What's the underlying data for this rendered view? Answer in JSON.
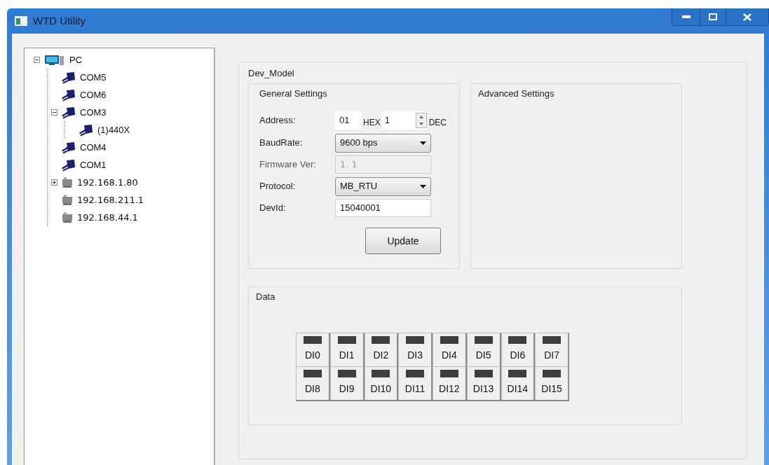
{
  "window": {
    "title": "WTD Utility"
  },
  "tree": [
    {
      "label": "PC",
      "kind": "pc",
      "expanded": true,
      "children": [
        {
          "label": "COM5",
          "kind": "serial"
        },
        {
          "label": "COM6",
          "kind": "serial"
        },
        {
          "label": "COM3",
          "kind": "serial",
          "expanded": true,
          "children": [
            {
              "label": "(1)440X",
              "kind": "serial"
            }
          ]
        },
        {
          "label": "COM4",
          "kind": "serial"
        },
        {
          "label": "COM1",
          "kind": "serial"
        },
        {
          "label": "192.168.1.80",
          "kind": "network",
          "expanded": false
        },
        {
          "label": "192.168.211.1",
          "kind": "network"
        },
        {
          "label": "192.168.44.1",
          "kind": "network"
        }
      ]
    }
  ],
  "dev_model": {
    "title": "Dev_Model",
    "general_settings": {
      "title": "General Settings",
      "address": {
        "label": "Address:",
        "hex_value": "01",
        "hex_unit": "HEX",
        "dec_value": "1",
        "dec_unit": "DEC"
      },
      "fields": [
        {
          "kind": "dropdown",
          "label": "BaudRate:",
          "value": "9600 bps"
        },
        {
          "kind": "text",
          "label": "Firmware Ver:",
          "value": "1. 1",
          "disabled": true
        },
        {
          "kind": "dropdown",
          "label": "Protocol:",
          "value": "MB_RTU"
        },
        {
          "kind": "text",
          "label": "DevId:",
          "value": "15040001",
          "disabled": false
        }
      ],
      "update_button": "Update"
    },
    "advanced_settings": {
      "title": "Advanced Settings"
    },
    "data": {
      "title": "Data",
      "inputs": [
        {
          "label": "DI0",
          "on": false
        },
        {
          "label": "DI1",
          "on": false
        },
        {
          "label": "DI2",
          "on": false
        },
        {
          "label": "DI3",
          "on": false
        },
        {
          "label": "DI4",
          "on": false
        },
        {
          "label": "DI5",
          "on": false
        },
        {
          "label": "DI6",
          "on": false
        },
        {
          "label": "DI7",
          "on": false
        },
        {
          "label": "DI8",
          "on": false
        },
        {
          "label": "DI9",
          "on": false
        },
        {
          "label": "DI10",
          "on": false
        },
        {
          "label": "DI11",
          "on": false
        },
        {
          "label": "DI12",
          "on": false
        },
        {
          "label": "DI13",
          "on": false
        },
        {
          "label": "DI14",
          "on": false
        },
        {
          "label": "DI15",
          "on": false
        }
      ]
    }
  }
}
